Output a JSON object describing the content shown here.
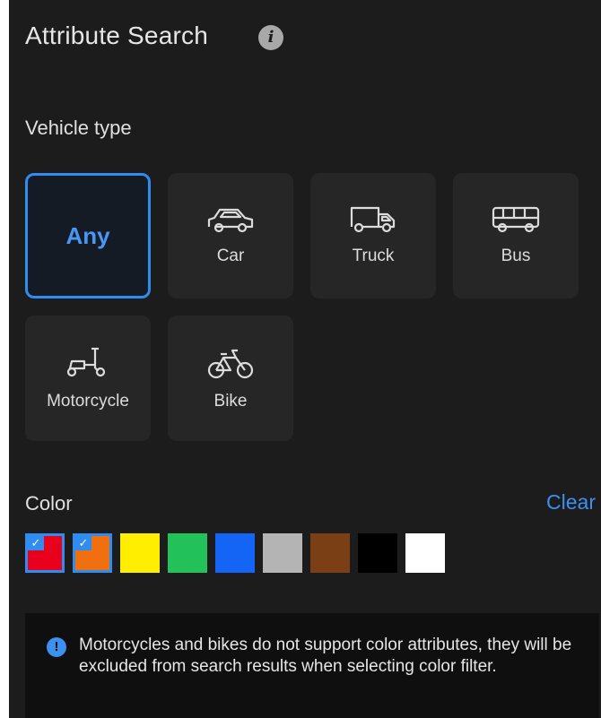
{
  "header": {
    "title": "Attribute Search",
    "info_icon": "info-icon"
  },
  "vehicle_type": {
    "label": "Vehicle type",
    "options": [
      {
        "label": "Any",
        "icon": "",
        "selected": true
      },
      {
        "label": "Car",
        "icon": "car-icon",
        "selected": false
      },
      {
        "label": "Truck",
        "icon": "truck-icon",
        "selected": false
      },
      {
        "label": "Bus",
        "icon": "bus-icon",
        "selected": false
      },
      {
        "label": "Motorcycle",
        "icon": "motorcycle-icon",
        "selected": false
      },
      {
        "label": "Bike",
        "icon": "bike-icon",
        "selected": false
      }
    ]
  },
  "color": {
    "label": "Color",
    "clear_label": "Clear",
    "swatches": [
      {
        "color": "#e8001c",
        "checked": true
      },
      {
        "color": "#f07010",
        "checked": true
      },
      {
        "color": "#ffee00",
        "checked": false
      },
      {
        "color": "#22c15a",
        "checked": false
      },
      {
        "color": "#1464f5",
        "checked": false
      },
      {
        "color": "#b4b4b4",
        "checked": false
      },
      {
        "color": "#7a3f14",
        "checked": false
      },
      {
        "color": "#000000",
        "checked": false
      },
      {
        "color": "#ffffff",
        "checked": false
      }
    ]
  },
  "notice": {
    "icon": "info-icon",
    "text": "Motorcycles and bikes do not support color attributes, they will be excluded from search results when selecting color filter."
  },
  "theme": {
    "accent": "#2f8cf0",
    "panel_bg": "#1c1c1c",
    "tile_bg": "#262626"
  }
}
